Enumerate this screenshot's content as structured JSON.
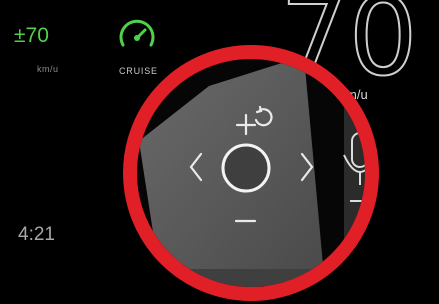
{
  "cluster": {
    "set_speed": "±70",
    "set_speed_unit": "km/u",
    "cruise_label": "CRUISE",
    "cruise_icon": "speedometer-icon",
    "current_speed": "70",
    "speed_unit": "m/u",
    "clock": "4:21"
  },
  "zoom": {
    "title": "steering-wheel-cruise-control-closeup",
    "buttons": [
      "increase-resume-button",
      "decrease-button",
      "left-button",
      "right-button",
      "center-button",
      "voice-button"
    ]
  },
  "colors": {
    "background": "#000000",
    "accent_green": "#4fd14a",
    "lens_ring": "#e01f26",
    "panel": "#5a5a5a"
  }
}
